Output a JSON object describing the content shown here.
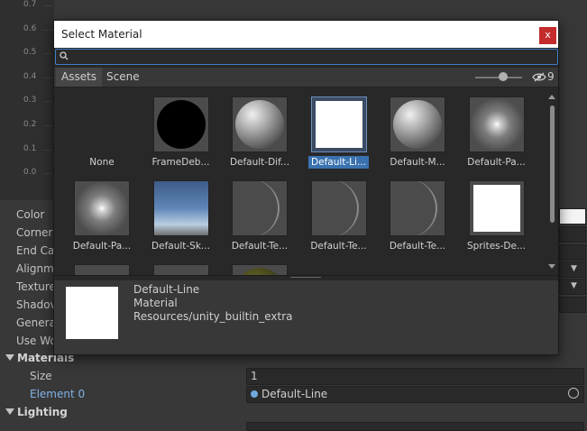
{
  "graph": {
    "y_ticks": [
      "0.7",
      "0.6",
      "0.5",
      "0.4",
      "0.3",
      "0.2",
      "0.1",
      "0.0"
    ]
  },
  "inspector": {
    "properties": [
      "Color",
      "Corner",
      "End Ca",
      "Alignme",
      "Texture",
      "Shadov",
      "Genera",
      "Use Wo"
    ],
    "materials_label": "Materials",
    "size_label": "Size",
    "size_value": "1",
    "element_label": "Element 0",
    "element_value": "Default-Line",
    "lighting_label": "Lighting"
  },
  "dialog": {
    "title": "Select Material",
    "close_label": "x",
    "search_value": "",
    "tabs": [
      "Assets",
      "Scene"
    ],
    "hidden_count": "9",
    "items": [
      {
        "label": "None",
        "kind": "none"
      },
      {
        "label": "FrameDeb...",
        "kind": "black"
      },
      {
        "label": "Default-Dif...",
        "kind": "sphere"
      },
      {
        "label": "Default-Li...",
        "kind": "white",
        "selected": true
      },
      {
        "label": "Default-M...",
        "kind": "sphere"
      },
      {
        "label": "Default-Pa...",
        "kind": "glow"
      },
      {
        "label": "Default-Pa...",
        "kind": "glow"
      },
      {
        "label": "Default-Sk...",
        "kind": "sky"
      },
      {
        "label": "Default-Te...",
        "kind": "arc"
      },
      {
        "label": "Default-Te...",
        "kind": "arc"
      },
      {
        "label": "Default-Te...",
        "kind": "arc"
      },
      {
        "label": "Sprites-De...",
        "kind": "white"
      },
      {
        "label": "",
        "kind": "plain"
      },
      {
        "label": "",
        "kind": "plain"
      },
      {
        "label": "",
        "kind": "moss"
      }
    ],
    "preview": {
      "name": "Default-Line",
      "type": "Material",
      "path": "Resources/unity_builtin_extra"
    }
  },
  "colors": {
    "accent": "#3a72b0",
    "close": "#c42b2b",
    "link": "#7fb2e8"
  }
}
